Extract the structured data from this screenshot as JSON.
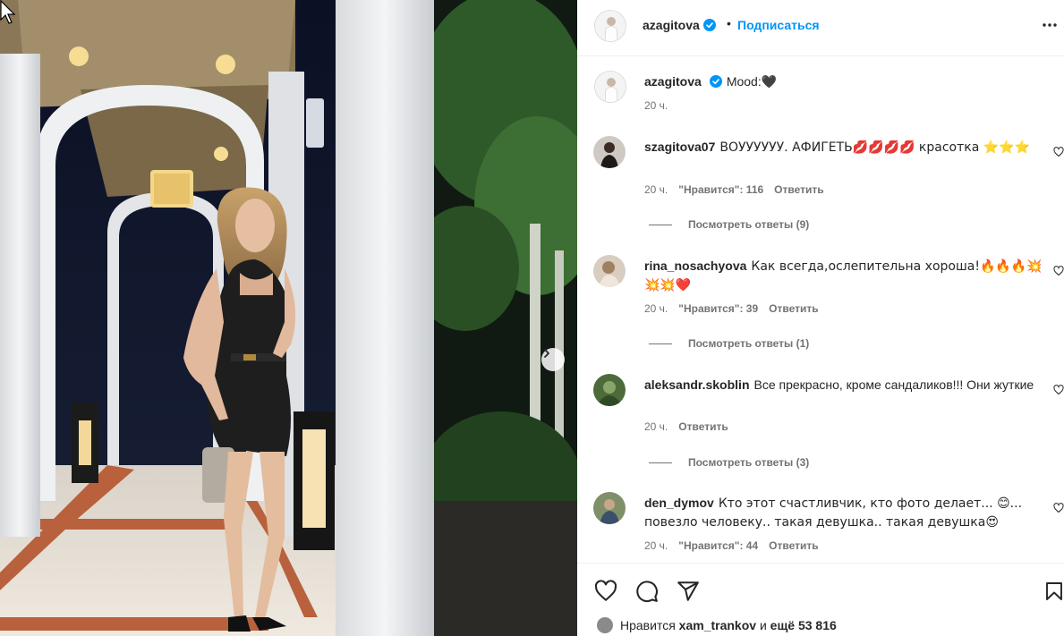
{
  "post": {
    "author": "azagitova",
    "follow_label": "Подписаться",
    "separator": "•",
    "caption_user": "azagitova",
    "caption_text": "Mood:",
    "caption_emoji": "🖤",
    "caption_time": "20 ч."
  },
  "comments": [
    {
      "user": "szagitova07",
      "text": "ВОУУУУУУ. АФИГЕТЬ💋💋💋💋 красотка ⭐⭐⭐",
      "time": "20 ч.",
      "likes": "\"Нравится\": 116",
      "reply": "Ответить",
      "view_replies": "Посмотреть ответы (9)"
    },
    {
      "user": "rina_nosachyova",
      "text": "Как всегда,ослепительна хороша!🔥🔥🔥💥💥💥❤️",
      "time": "20 ч.",
      "likes": "\"Нравится\": 39",
      "reply": "Ответить",
      "view_replies": "Посмотреть ответы (1)"
    },
    {
      "user": "aleksandr.skoblin",
      "text": "Все прекрасно, кроме сандаликов!!! Они жуткие",
      "time": "20 ч.",
      "likes": "",
      "reply": "Ответить",
      "view_replies": "Посмотреть ответы (3)"
    },
    {
      "user": "den_dymov",
      "text": "Кто этот счастливчик, кто фото делает... 😊... повезло человеку.. такая девушка.. такая девушка😍",
      "time": "20 ч.",
      "likes": "\"Нравится\": 44",
      "reply": "Ответить",
      "view_replies": ""
    }
  ],
  "likes_summary": {
    "prefix": "Нравится",
    "user": "xam_trankov",
    "middle": "и",
    "rest": "ещё 53 816"
  },
  "icons": {
    "verified": "verified-badge-icon",
    "more": "more-options-icon",
    "like": "heart-icon",
    "comment": "comment-icon",
    "share": "share-icon",
    "save": "bookmark-icon",
    "next": "chevron-right-icon"
  },
  "colors": {
    "accent": "#0095f6",
    "verified": "#0095f6",
    "muted": "#737373",
    "text": "#262626"
  }
}
